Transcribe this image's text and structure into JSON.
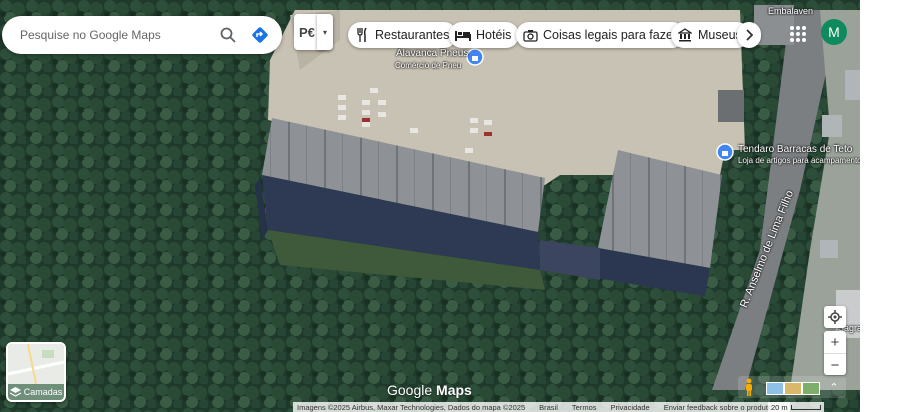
{
  "search": {
    "placeholder": "Pesquise no Google Maps"
  },
  "transit_label": "P€",
  "chips": [
    {
      "label": "Restaurantes",
      "icon": "fork-knife-icon"
    },
    {
      "label": "Hotéis",
      "icon": "bed-icon"
    },
    {
      "label": "Coisas legais para fazer",
      "icon": "camera-icon"
    },
    {
      "label": "Museus",
      "icon": "museum-icon"
    }
  ],
  "account": {
    "initial": "M",
    "color": "#0f8a5f"
  },
  "pois": [
    {
      "name": "Alavanca Pneus",
      "sub": "Comércio de Pneu"
    },
    {
      "name": "Tendaro Barracas de Teto",
      "sub": "Loja de artigos para acampamento"
    },
    {
      "name": "Embalaven",
      "sub": ""
    },
    {
      "name": "Sagrada Família",
      "sub": ""
    }
  ],
  "street": "R. Anselmo de Lima Filho",
  "layers_label": "Camadas",
  "logo": {
    "a": "Google",
    "b": "Maps"
  },
  "footer": {
    "imagery": "Imagens ©2025 Airbus, Maxar Technologies, Dados do mapa ©2025",
    "country": "Brasil",
    "terms": "Termos",
    "privacy": "Privacidade",
    "feedback": "Enviar feedback sobre o produto",
    "scale": "20 m"
  },
  "colors": {
    "accent": "#1a73e8",
    "poi_blue": "#4285f4"
  }
}
